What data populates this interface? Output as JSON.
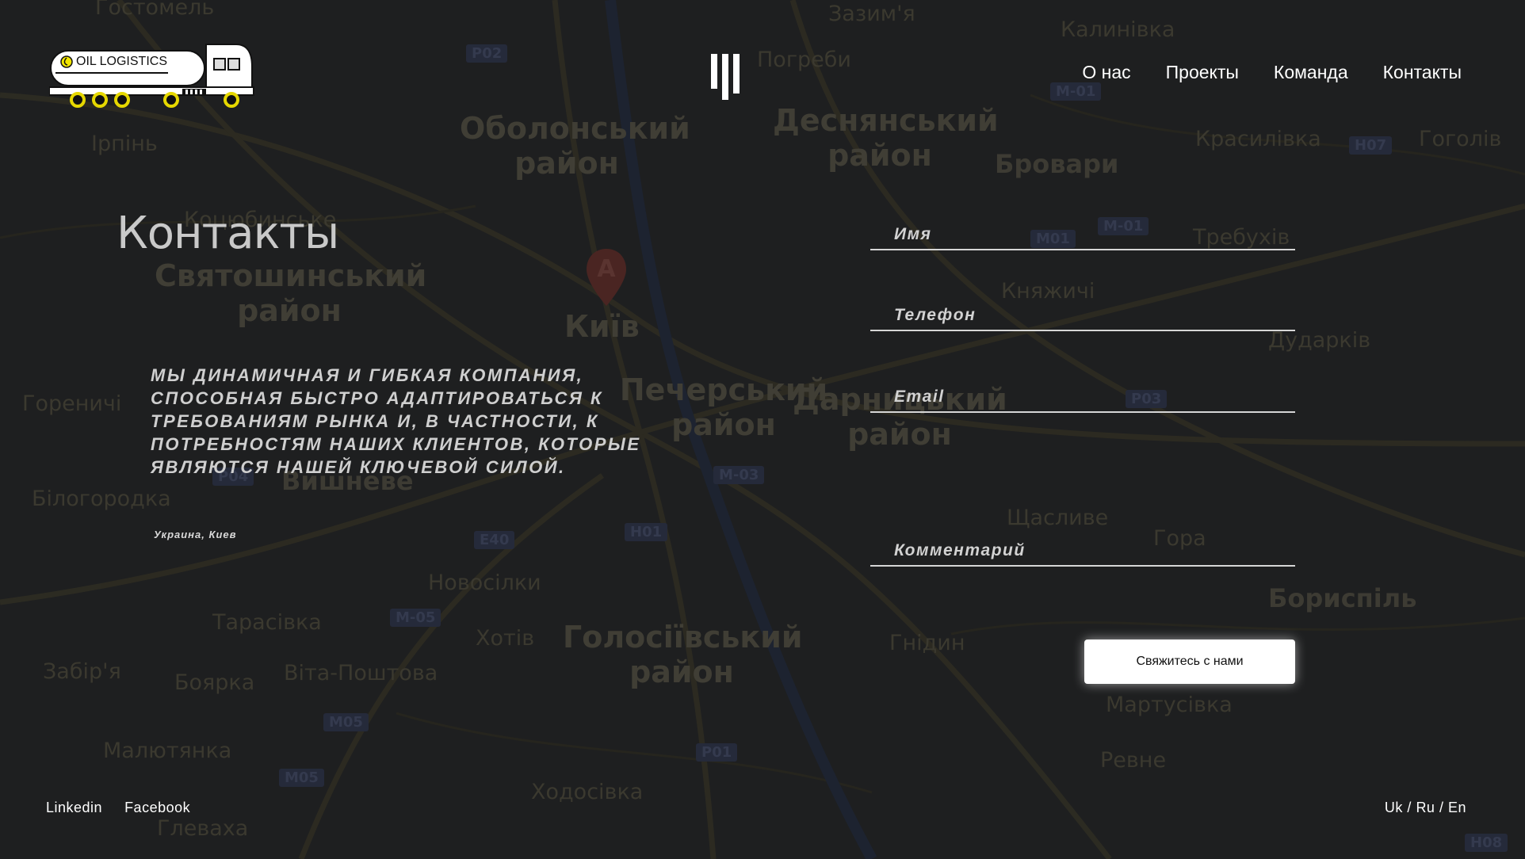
{
  "colors": {
    "background": "#1e1f20",
    "text": "#ffffff",
    "button_bg": "#ffffff",
    "logo_accent": "#f2e600"
  },
  "logo": {
    "text": "OIL LOGISTICS"
  },
  "nav": [
    {
      "label": "О нас"
    },
    {
      "label": "Проекты"
    },
    {
      "label": "Команда"
    },
    {
      "label": "Контакты"
    }
  ],
  "page_title": "Контакты",
  "slogan": "Мы динамичная и гибкая компания, способная быстро адаптироваться к требованиям рынка и, в частности, к потребностям наших клиентов, которые являются нашей ключевой силой.",
  "location": "Украина, Киев",
  "form": {
    "name_placeholder": "Имя",
    "phone_placeholder": "Телефон",
    "email_placeholder": "Email",
    "comment_placeholder": "Комментарий",
    "submit_label": "Свяжитесь с нами"
  },
  "footer": {
    "social": [
      {
        "label": "Linkedin"
      },
      {
        "label": "Facebook"
      }
    ],
    "languages": [
      "Uk",
      "Ru",
      "En"
    ],
    "lang_separator": " / "
  },
  "map": {
    "marker_label": "A",
    "labels": [
      {
        "text": "Оболонський район"
      },
      {
        "text": "Деснянський район"
      },
      {
        "text": "Святошинський район"
      },
      {
        "text": "Київ"
      },
      {
        "text": "Печерський район"
      },
      {
        "text": "Дарницький район"
      },
      {
        "text": "Голосіївський район"
      },
      {
        "text": "Бровари"
      },
      {
        "text": "Вишневе"
      },
      {
        "text": "Бориспіль"
      },
      {
        "text": "Гостомель"
      },
      {
        "text": "Зазим'я"
      },
      {
        "text": "Погреби"
      },
      {
        "text": "Калинівка"
      },
      {
        "text": "Красилівка"
      },
      {
        "text": "Гоголів"
      },
      {
        "text": "Ірпінь"
      },
      {
        "text": "Требухів"
      },
      {
        "text": "Княжичі"
      },
      {
        "text": "Дударків"
      },
      {
        "text": "Гореничі"
      },
      {
        "text": "Білогородка"
      },
      {
        "text": "Новосілки"
      },
      {
        "text": "Тарасівка"
      },
      {
        "text": "Хотів"
      },
      {
        "text": "Щасливе"
      },
      {
        "text": "Гора"
      },
      {
        "text": "Забір'я"
      },
      {
        "text": "Боярка"
      },
      {
        "text": "Віта-Поштова"
      },
      {
        "text": "Гнідин"
      },
      {
        "text": "Мартусівка"
      },
      {
        "text": "Малютянка"
      },
      {
        "text": "Ходосівка"
      },
      {
        "text": "Ревне"
      },
      {
        "text": "Глеваха"
      },
      {
        "text": "Коцюбинське"
      }
    ],
    "roads": [
      "Р02",
      "М-01",
      "Н07",
      "М01",
      "М-01",
      "Р03",
      "Р04",
      "М-03",
      "Н01",
      "Е40",
      "М-05",
      "М05",
      "М05",
      "Р01",
      "Н08"
    ]
  }
}
